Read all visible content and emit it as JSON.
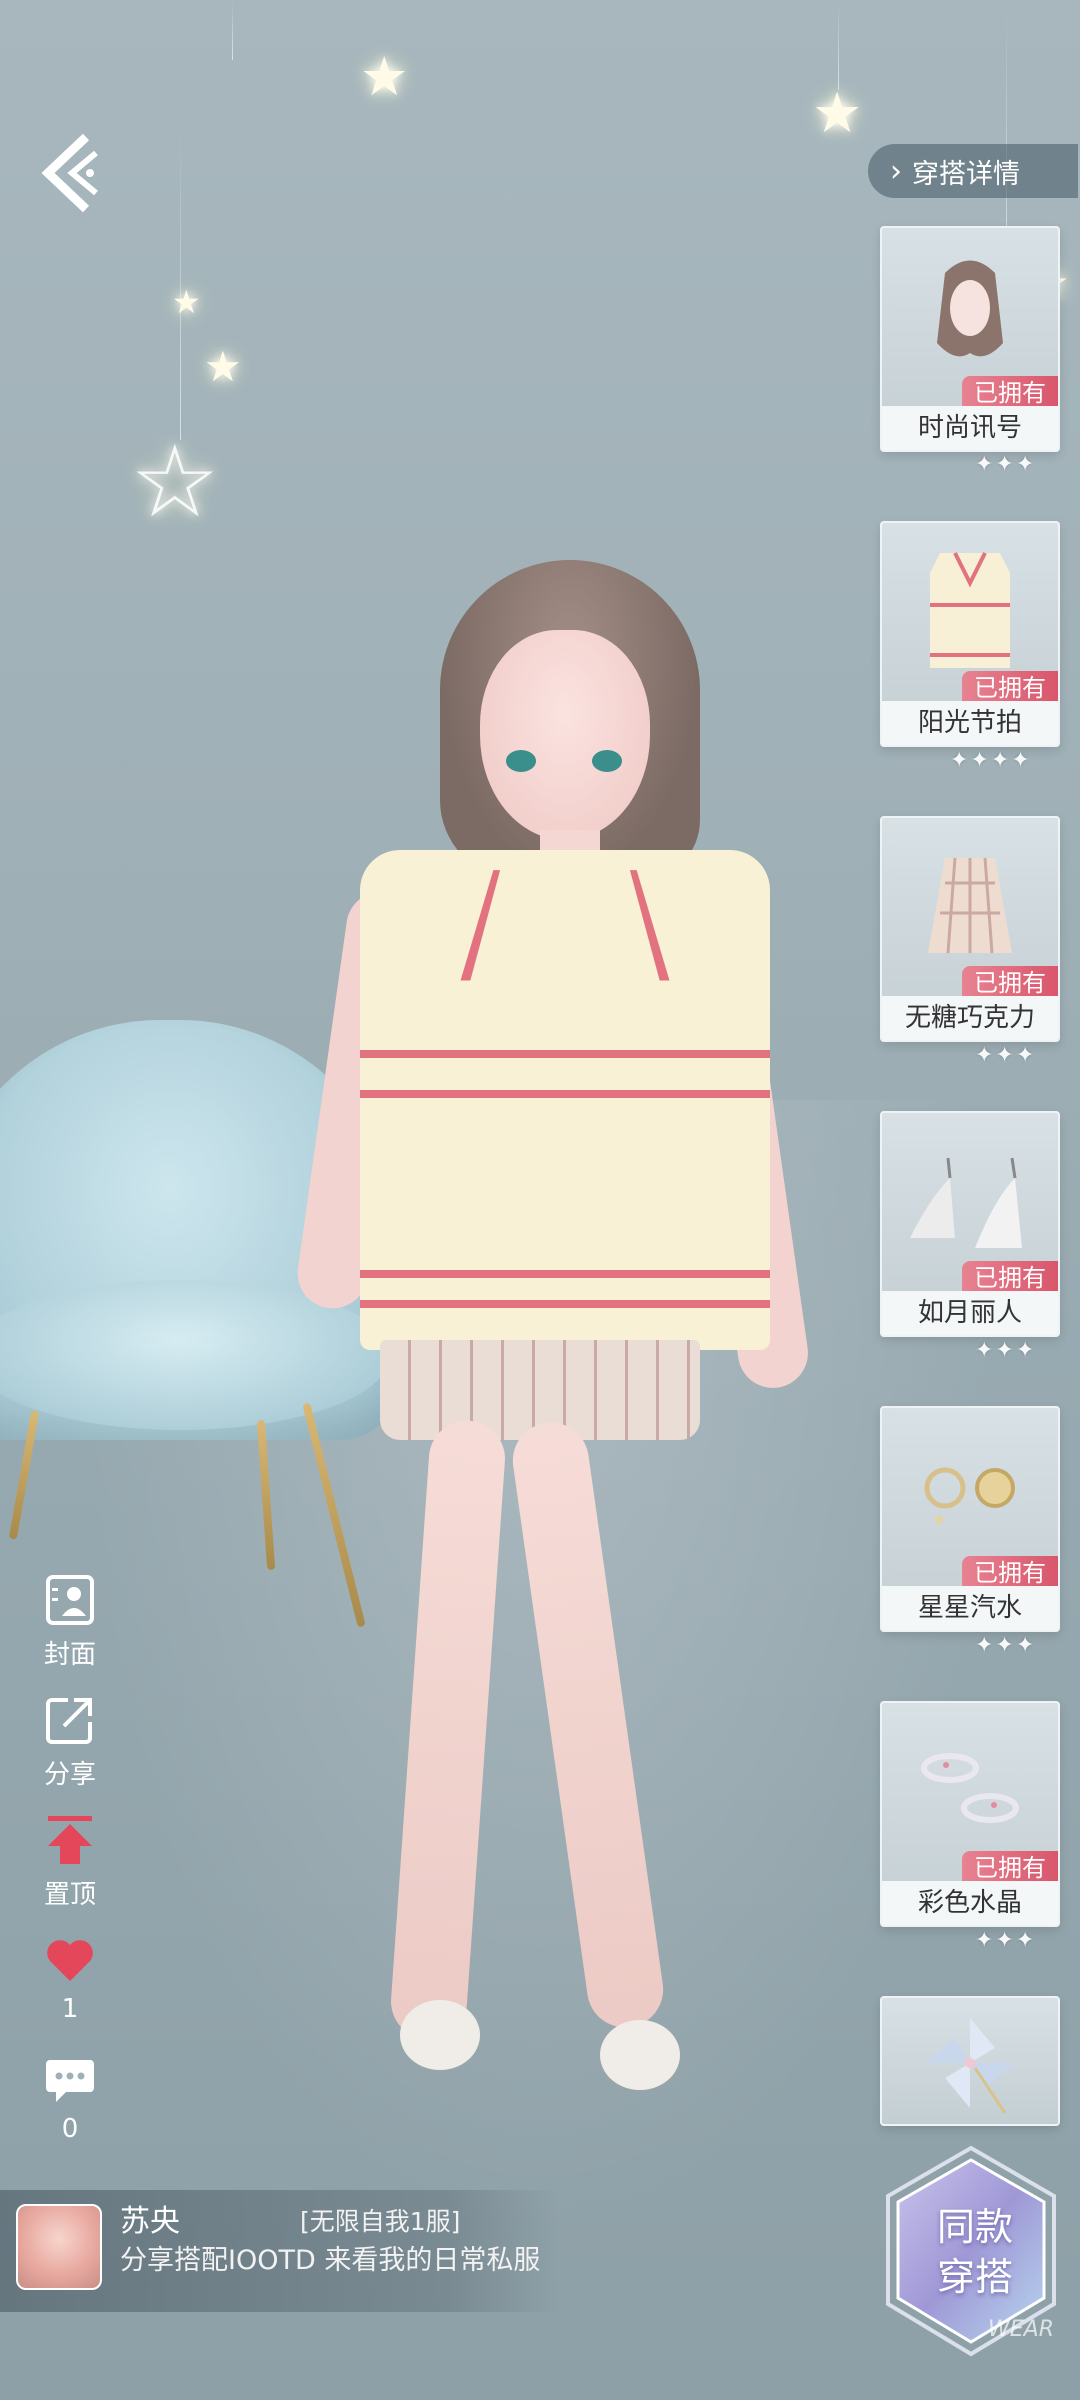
{
  "header": {
    "outfit_detail_label": "穿搭详情"
  },
  "items": [
    {
      "name": "时尚讯号",
      "status": "已拥有",
      "rating": "✦✦✦",
      "icon": "hair-icon"
    },
    {
      "name": "阳光节拍",
      "status": "已拥有",
      "rating": "✦✦✦✦",
      "icon": "sweater-vest-icon"
    },
    {
      "name": "无糖巧克力",
      "status": "已拥有",
      "rating": "✦✦✦",
      "icon": "skirt-icon"
    },
    {
      "name": "如月丽人",
      "status": "已拥有",
      "rating": "✦✦✦",
      "icon": "heels-icon"
    },
    {
      "name": "星星汽水",
      "status": "已拥有",
      "rating": "✦✦✦",
      "icon": "earrings-icon"
    },
    {
      "name": "彩色水晶",
      "status": "已拥有",
      "rating": "✦✦✦",
      "icon": "bracelet-icon"
    },
    {
      "name": "",
      "status": "",
      "rating": "",
      "icon": "pinwheel-icon"
    }
  ],
  "actions": {
    "cover_label": "封面",
    "share_label": "分享",
    "pin_label": "置顶",
    "like_count": "1",
    "comment_count": "0"
  },
  "post": {
    "username": "苏央",
    "tag": "[无限自我1服]",
    "description": "分享搭配IOOTD 来看我的日常私服"
  },
  "same_outfit": {
    "line1": "同款",
    "line2": "穿搭",
    "watermark": "WEAR"
  },
  "colors": {
    "owned_badge": "#d9566b",
    "like_heart": "#e4465a",
    "pin_arrow": "#e4465a",
    "background": "#a7b7bd"
  }
}
